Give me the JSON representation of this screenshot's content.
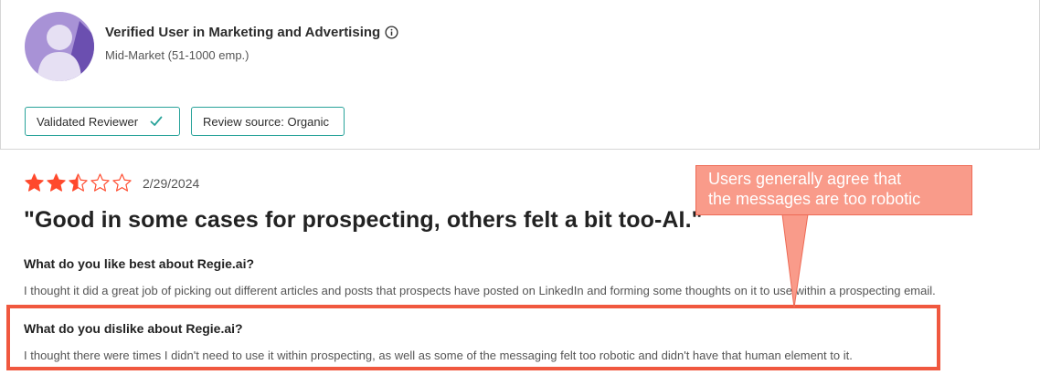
{
  "reviewer": {
    "name": "Verified User in Marketing and Advertising",
    "segment": "Mid-Market (51-1000 emp.)",
    "badges": {
      "validated": "Validated Reviewer",
      "source": "Review source: Organic"
    }
  },
  "review": {
    "rating": 2.5,
    "max_rating": 5,
    "star_color": "#ff492c",
    "date": "2/29/2024",
    "title": "\"Good in some cases for prospecting, others felt a bit too-AI.\"",
    "questions": [
      {
        "question": "What do you like best about Regie.ai?",
        "answer": "I thought it did a great job of picking out different articles and posts that prospects have posted on LinkedIn and forming some thoughts on it to use within a prospecting email."
      },
      {
        "question": "What do you dislike about Regie.ai?",
        "answer": "I thought there were times I didn't need to use it within prospecting, as well as some of the messaging felt too robotic and didn't have that human element to it."
      }
    ]
  },
  "annotation": {
    "callout_line1": "Users generally agree that",
    "callout_line2": "the messages are too robotic",
    "highlight_color": "#f0583f",
    "callout_color": "#f99b8a"
  },
  "colors": {
    "avatar_bg": "#a892d6",
    "badge_border": "#29a39a"
  }
}
